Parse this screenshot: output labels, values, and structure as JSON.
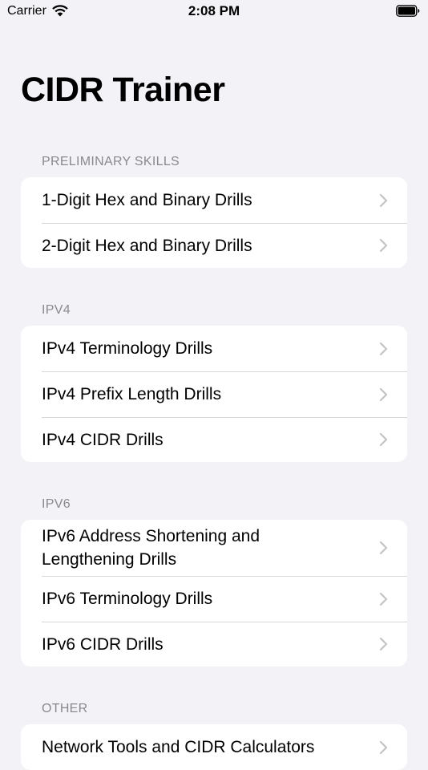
{
  "status_bar": {
    "carrier": "Carrier",
    "time": "2:08 PM"
  },
  "title": "CIDR Trainer",
  "sections": [
    {
      "header": "PRELIMINARY SKILLS",
      "items": [
        {
          "label": "1-Digit Hex and Binary Drills"
        },
        {
          "label": "2-Digit Hex and Binary Drills"
        }
      ]
    },
    {
      "header": "IPV4",
      "items": [
        {
          "label": "IPv4 Terminology Drills"
        },
        {
          "label": "IPv4 Prefix Length Drills"
        },
        {
          "label": "IPv4 CIDR Drills"
        }
      ]
    },
    {
      "header": "IPV6",
      "items": [
        {
          "label": "IPv6 Address Shortening and Lengthening Drills"
        },
        {
          "label": "IPv6 Terminology Drills"
        },
        {
          "label": "IPv6 CIDR Drills"
        }
      ]
    },
    {
      "header": "OTHER",
      "items": [
        {
          "label": "Network Tools and CIDR Calculators"
        }
      ]
    }
  ],
  "colors": {
    "background": "#f2f2f7",
    "section_header": "#8a8a8e",
    "separator": "#d8d8dc",
    "chevron": "#c4c4c7"
  }
}
